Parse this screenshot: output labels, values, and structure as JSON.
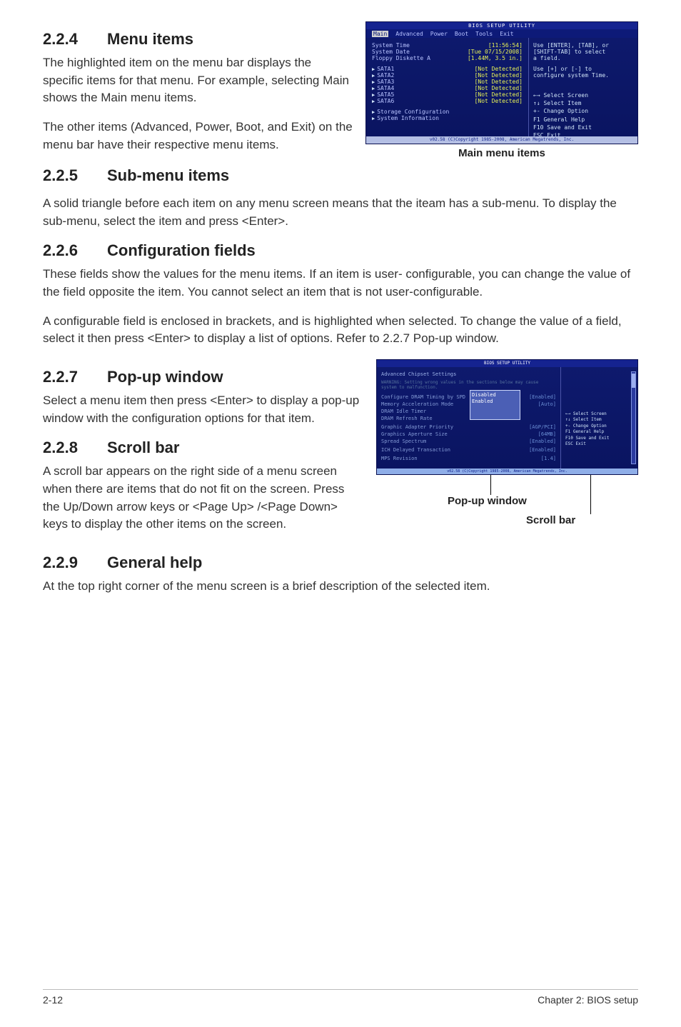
{
  "sections": {
    "s224": {
      "num": "2.2.4",
      "title": "Menu items",
      "p1": "The highlighted item on the menu bar displays the specific items for that menu. For example, selecting Main shows the Main menu items.",
      "p2": "The other items (Advanced, Power, Boot, and Exit) on the menu bar have their respective menu items."
    },
    "s225": {
      "num": "2.2.5",
      "title": "Sub-menu items",
      "p1": "A solid triangle before each item on any menu screen means that the iteam has a sub-menu. To display the sub-menu, select the item and press <Enter>."
    },
    "s226": {
      "num": "2.2.6",
      "title": "Configuration fields",
      "p1": "These fields show the values for the menu items. If an item is user- configurable, you can change the value of the field opposite the item. You cannot select an item that is not user-configurable.",
      "p2": "A configurable field is enclosed in brackets, and is highlighted when selected. To change the value of a field, select it then press <Enter> to display a list of options. Refer to 2.2.7 Pop-up window."
    },
    "s227": {
      "num": "2.2.7",
      "title": "Pop-up window",
      "p1": "Select a menu item then press <Enter> to display a pop-up window with the configuration options for that item."
    },
    "s228": {
      "num": "2.2.8",
      "title": "Scroll bar",
      "p1": "A scroll bar appears on the right side of a menu screen when there are items that do not fit on the screen. Press the Up/Down arrow keys or <Page Up> /<Page Down> keys to display the other items on the screen."
    },
    "s229": {
      "num": "2.2.9",
      "title": "General help",
      "p1": "At the top right corner of the menu screen is a brief description of the selected item."
    }
  },
  "fig1": {
    "caption": "Main menu items",
    "title_bar": "BIOS SETUP UTILITY",
    "menus": {
      "main": "Main",
      "advanced": "Advanced",
      "power": "Power",
      "boot": "Boot",
      "tools": "Tools",
      "exit": "Exit"
    },
    "rows": {
      "systime": {
        "label": "System Time",
        "val": "[11:56:54]"
      },
      "sysdate": {
        "label": "System Date",
        "val": "[Tue 07/15/2008]"
      },
      "floppy": {
        "label": "Floppy Diskette A",
        "val": "[1.44M, 3.5 in.]"
      },
      "sata1": {
        "label": "SATA1",
        "val": "[Not Detected]"
      },
      "sata2": {
        "label": "SATA2",
        "val": "[Not Detected]"
      },
      "sata3": {
        "label": "SATA3",
        "val": "[Not Detected]"
      },
      "sata4": {
        "label": "SATA4",
        "val": "[Not Detected]"
      },
      "sata5": {
        "label": "SATA5",
        "val": "[Not Detected]"
      },
      "sata6": {
        "label": "SATA6",
        "val": "[Not Detected]"
      },
      "storage": {
        "label": "Storage Configuration"
      },
      "sysinfo": {
        "label": "System Information"
      }
    },
    "help": {
      "l1": "Use [ENTER], [TAB], or",
      "l2": "[SHIFT-TAB] to select",
      "l3": "a field.",
      "l4": "Use [+] or [-] to",
      "l5": "configure system Time.",
      "k1": "←→   Select Screen",
      "k2": "↑↓   Select Item",
      "k3": "+-   Change Option",
      "k4": "F1   General Help",
      "k5": "F10  Save and Exit",
      "k6": "ESC  Exit"
    },
    "footer": "v02.58 (C)Copyright 1985-2008, American Megatrends, Inc."
  },
  "fig2": {
    "title_bar": "BIOS SETUP UTILITY",
    "heading": "Advanced Chipset Settings",
    "warn": "WARNING: Setting wrong values in the sections below may cause system to malfunction.",
    "rows": {
      "r1": {
        "label": "Configure DRAM Timing by SPD",
        "val": "[Enabled]"
      },
      "r2": {
        "label": "Memory Acceleration Mode",
        "val": "[Auto]"
      },
      "r3": {
        "label": "DRAM Idle Timer",
        "val": ""
      },
      "r4": {
        "label": "DRAM Refresh Rate",
        "val": ""
      },
      "r5": {
        "label": "Graphic Adapter Priority",
        "val": "[AGP/PCI]"
      },
      "r6": {
        "label": "Graphics Aperture Size",
        "val": "[64MB]"
      },
      "r7": {
        "label": "Spread Spectrum",
        "val": "[Enabled]"
      },
      "r8": {
        "label": "ICH Delayed Transaction",
        "val": "[Enabled]"
      },
      "r9": {
        "label": "MPS Revision",
        "val": "[1.4]"
      }
    },
    "popup": {
      "o1": "Disabled",
      "o2": "Enabled"
    },
    "help": {
      "k1": "←→   Select Screen",
      "k2": "↑↓   Select Item",
      "k3": "+-   Change Option",
      "k4": "F1   General Help",
      "k5": "F10  Save and Exit",
      "k6": "ESC  Exit"
    },
    "footer": "v02.58 (C)Copyright 1985-2008, American Megatrends, Inc.",
    "labels": {
      "popup": "Pop-up window",
      "scroll": "Scroll bar"
    }
  },
  "footer": {
    "left": "2-12",
    "right": "Chapter 2: BIOS setup"
  }
}
